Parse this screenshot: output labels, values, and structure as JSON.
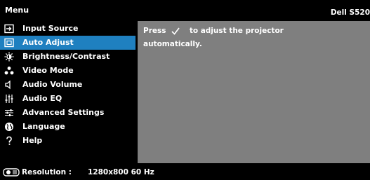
{
  "header": {
    "title": "Menu",
    "model": "Dell S520"
  },
  "menu": {
    "items": [
      {
        "label": "Input Source",
        "icon": "input-source-icon"
      },
      {
        "label": "Auto Adjust",
        "icon": "auto-adjust-icon",
        "selected": true
      },
      {
        "label": "Brightness/Contrast",
        "icon": "brightness-icon"
      },
      {
        "label": "Video Mode",
        "icon": "video-mode-icon"
      },
      {
        "label": "Audio Volume",
        "icon": "speaker-icon"
      },
      {
        "label": "Audio EQ",
        "icon": "equalizer-icon"
      },
      {
        "label": "Advanced Settings",
        "icon": "sliders-icon"
      },
      {
        "label": "Language",
        "icon": "globe-icon"
      },
      {
        "label": "Help",
        "icon": "question-icon"
      }
    ]
  },
  "panel": {
    "line1_before": "Press",
    "line1_after": "to adjust the projector",
    "line2": "automatically."
  },
  "footer": {
    "label": "Resolution :",
    "value": "1280x800 60 Hz"
  },
  "colors": {
    "selected": "#1f80c0",
    "panel": "#7f7f7f",
    "background": "#000000"
  }
}
